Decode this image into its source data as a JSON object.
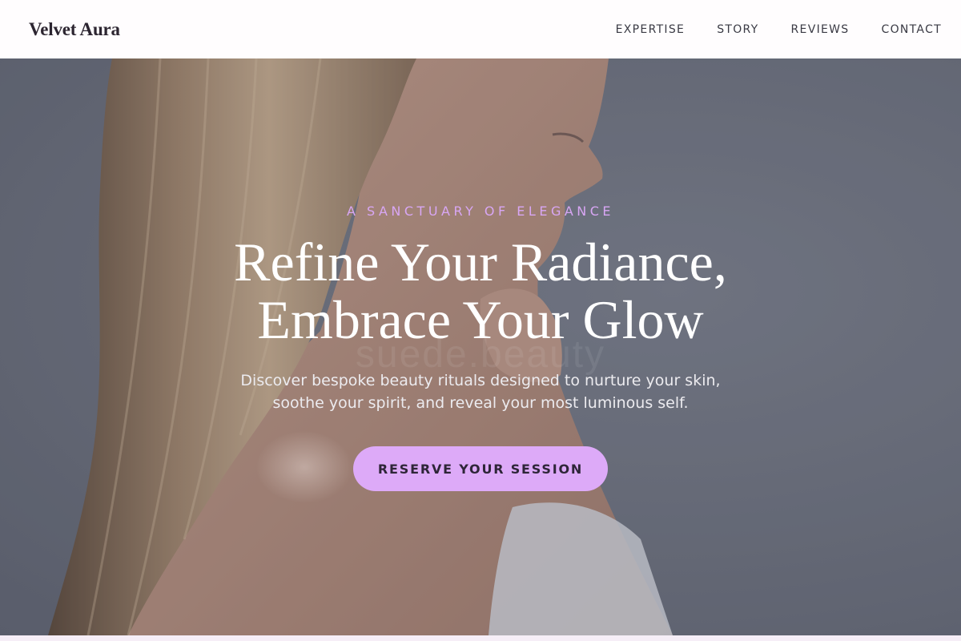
{
  "header": {
    "logo": "Velvet Aura",
    "nav": [
      "EXPERTISE",
      "STORY",
      "REVIEWS",
      "CONTACT"
    ]
  },
  "hero": {
    "eyebrow": "A SANCTUARY OF ELEGANCE",
    "headline_line1": "Refine Your Radiance,",
    "headline_line2": "Embrace Your Glow",
    "subhead_line1": "Discover bespoke beauty rituals designed to nurture your skin,",
    "subhead_line2": "soothe your spirit, and reveal your most luminous self.",
    "cta_label": "RESERVE YOUR SESSION",
    "watermark": "suede.beauty",
    "image": "woman-profile-photo"
  },
  "colors": {
    "accent": "#ddaaf8",
    "eyebrow": "#d8a6f4",
    "logo": "#2c2530",
    "hero_overlay": "#6b6f7c"
  }
}
